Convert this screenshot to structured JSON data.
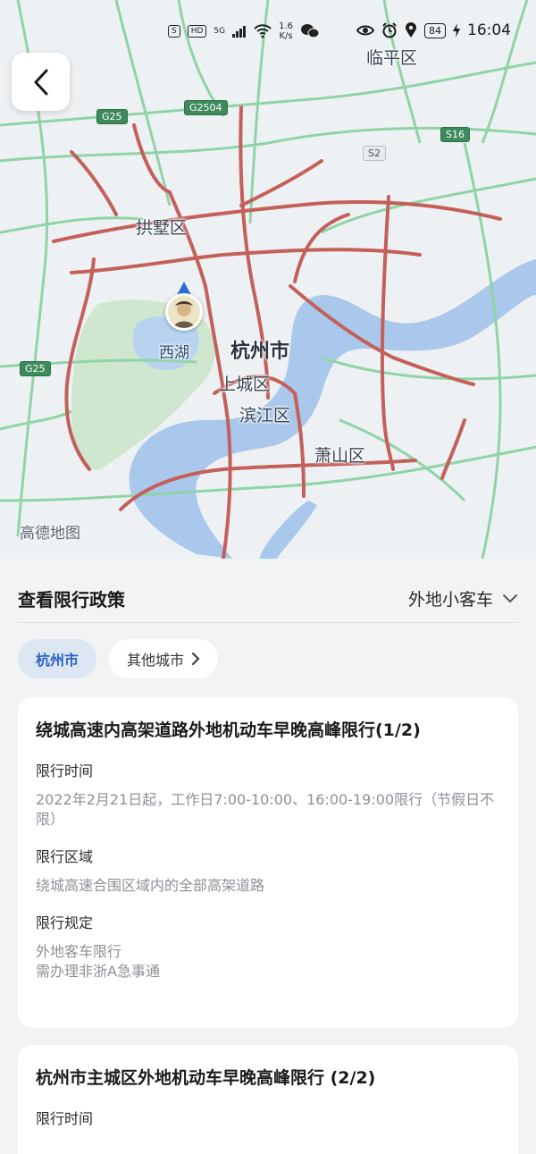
{
  "status_bar": {
    "sim_badge": "S",
    "hd_badge": "HD",
    "network": "5G",
    "speed_value": "1.6",
    "speed_unit": "K/s",
    "battery": "84",
    "time": "16:04"
  },
  "map": {
    "district_labels": {
      "linping": "临平区",
      "gongshu": "拱墅区",
      "xihu": "西湖",
      "hangzhou": "杭州市",
      "shangcheng": "上城区",
      "binjiang": "滨江区",
      "xiaoshan": "萧山区"
    },
    "road_shields": {
      "g25_top": "G25",
      "g2504": "G2504",
      "s16": "S16",
      "s2": "S2",
      "g25_left": "G25"
    },
    "watermark": "高德地图",
    "icons": {
      "back": "back-arrow-icon",
      "eye": "eye-icon",
      "alarm": "alarm-icon",
      "location": "location-icon",
      "wechat": "wechat-icon",
      "wifi": "wifi-icon",
      "signal": "signal-icon",
      "charging": "charging-icon"
    },
    "colors": {
      "congestion": "#c4605a",
      "water": "#a9c8ec",
      "park": "#cfe6cf",
      "road": "#8fd4a6"
    }
  },
  "panel": {
    "title": "查看限行政策",
    "vehicle_type": "外地小客车",
    "chips": {
      "current_city": "杭州市",
      "other_cities": "其他城市"
    }
  },
  "policies": [
    {
      "title": "绕城高速内高架道路外地机动车早晚高峰限行(1/2)",
      "time_label": "限行时间",
      "time_value": "2022年2月21日起，工作日7:00-10:00、16:00-19:00限行（节假日不限）",
      "area_label": "限行区域",
      "area_value": "绕城高速合围区域内的全部高架道路",
      "rule_label": "限行规定",
      "rule_value_1": "外地客车限行",
      "rule_value_2": "需办理非浙A急事通"
    },
    {
      "title": "杭州市主城区外地机动车早晚高峰限行 (2/2)",
      "time_label": "限行时间"
    }
  ]
}
